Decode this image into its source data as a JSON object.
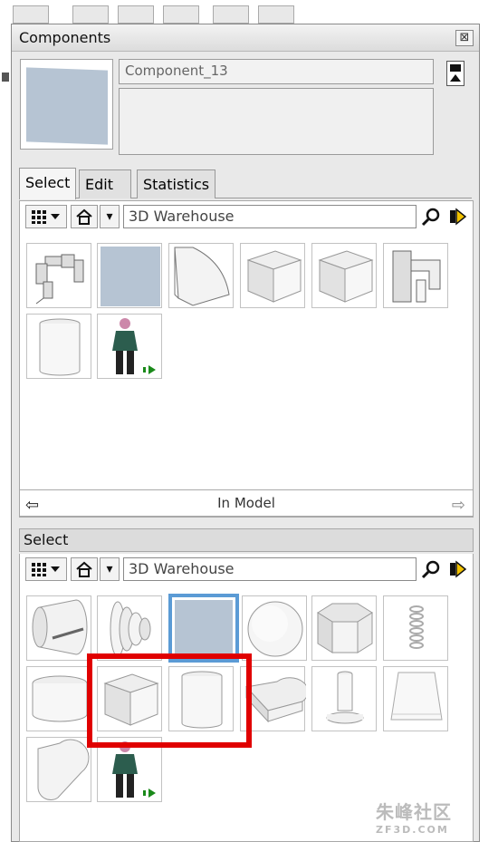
{
  "window": {
    "title": "Components",
    "close_glyph": "⊠"
  },
  "component": {
    "name": "Component_13",
    "description": ""
  },
  "tabs": [
    {
      "label": "Select",
      "active": true
    },
    {
      "label": "Edit",
      "active": false
    },
    {
      "label": "Statistics",
      "active": false
    }
  ],
  "top_browser": {
    "search_value": "3D Warehouse",
    "view_glyph": "▦",
    "home_glyph": "⌂",
    "dropdown_glyph": "▾",
    "items": [
      {
        "name": "robot-arm",
        "icon": "robot-arm-icon"
      },
      {
        "name": "blue-square",
        "icon": "square-face-icon"
      },
      {
        "name": "bent-sheet",
        "icon": "bent-sheet-icon"
      },
      {
        "name": "cube-1",
        "icon": "cube-icon"
      },
      {
        "name": "cube-2",
        "icon": "cube-icon"
      },
      {
        "name": "bracket",
        "icon": "bracket-icon"
      },
      {
        "name": "cylinder",
        "icon": "cylinder-icon"
      },
      {
        "name": "person",
        "icon": "person-icon"
      }
    ],
    "nav_label": "In Model",
    "nav_back": "⇦",
    "nav_forward": "⇨"
  },
  "bottom_browser": {
    "header": "Select",
    "search_value": "3D Warehouse",
    "items": [
      {
        "name": "cone-cylinder",
        "icon": "cone-icon"
      },
      {
        "name": "pulley",
        "icon": "pulley-icon"
      },
      {
        "name": "blue-square",
        "icon": "square-face-icon"
      },
      {
        "name": "sphere",
        "icon": "sphere-icon"
      },
      {
        "name": "hex-prism",
        "icon": "hexagon-prism-icon"
      },
      {
        "name": "spring",
        "icon": "spring-icon"
      },
      {
        "name": "disc",
        "icon": "disc-icon"
      },
      {
        "name": "cube",
        "icon": "cube-icon"
      },
      {
        "name": "cylinder",
        "icon": "cylinder-icon"
      },
      {
        "name": "slot",
        "icon": "slot-icon"
      },
      {
        "name": "pin",
        "icon": "pin-icon"
      },
      {
        "name": "frustum",
        "icon": "frustum-icon"
      },
      {
        "name": "capsule",
        "icon": "capsule-icon"
      },
      {
        "name": "person",
        "icon": "person-icon"
      }
    ]
  },
  "colors": {
    "selection": "#5b9bd5",
    "highlight": "#e00000",
    "face": "#b6c4d3"
  },
  "watermark": {
    "text": "朱峰社区",
    "sub": "ZF3D.COM"
  }
}
